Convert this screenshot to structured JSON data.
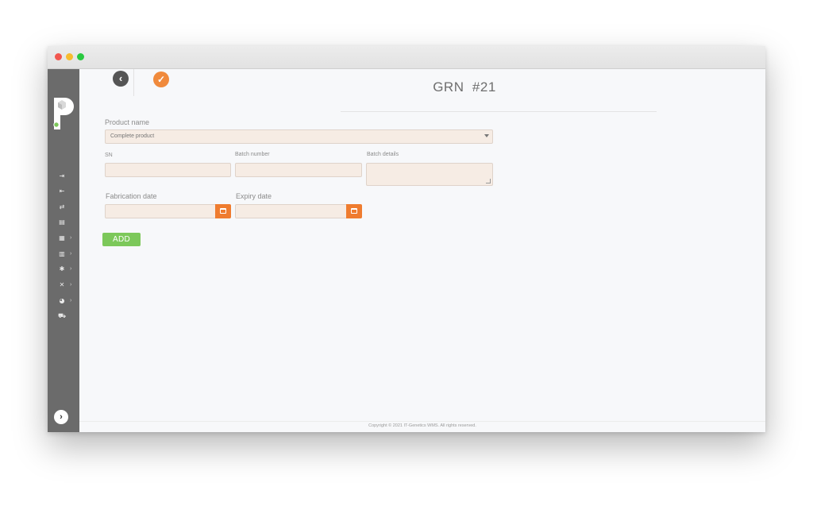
{
  "window": {
    "controls": [
      "close",
      "minimize",
      "maximize"
    ]
  },
  "sidebar": {
    "logo_letter": "P",
    "items": [
      {
        "icon": "sign-in-icon",
        "glyph": "⇥",
        "has_submenu": false
      },
      {
        "icon": "sign-out-icon",
        "glyph": "⇤",
        "has_submenu": false
      },
      {
        "icon": "transfer-icon",
        "glyph": "⇄",
        "has_submenu": false
      },
      {
        "icon": "document-icon",
        "glyph": "▤",
        "has_submenu": false
      },
      {
        "icon": "clipboard-icon",
        "glyph": "▦",
        "has_submenu": true
      },
      {
        "icon": "warehouse-icon",
        "glyph": "▥",
        "has_submenu": true
      },
      {
        "icon": "gear-icon",
        "glyph": "✱",
        "has_submenu": true
      },
      {
        "icon": "tools-icon",
        "glyph": "✕",
        "has_submenu": true
      },
      {
        "icon": "pie-chart-icon",
        "glyph": "◕",
        "has_submenu": true
      },
      {
        "icon": "cart-icon",
        "glyph": "⛟",
        "has_submenu": false
      }
    ],
    "submenu_glyph": "›",
    "expand_glyph": "›"
  },
  "header": {
    "back_glyph": "‹",
    "confirm_glyph": "✓",
    "title": "GRN  #21"
  },
  "form": {
    "product_name": {
      "label": "Product name",
      "value": "Complete product"
    },
    "sn": {
      "label": "SN",
      "value": ""
    },
    "batch_number": {
      "label": "Batch number",
      "value": ""
    },
    "batch_details": {
      "label": "Batch details",
      "value": ""
    },
    "fabrication_date": {
      "label": "Fabrication date",
      "value": ""
    },
    "expiry_date": {
      "label": "Expiry date",
      "value": ""
    },
    "add_label": "ADD"
  },
  "footer": {
    "copyright": "Copyright © 2021 IT-Genetics WMS. All rights reserved."
  },
  "colors": {
    "accent": "#f08a3c",
    "success": "#7cc85a",
    "sidebar": "#6b6b6b"
  }
}
